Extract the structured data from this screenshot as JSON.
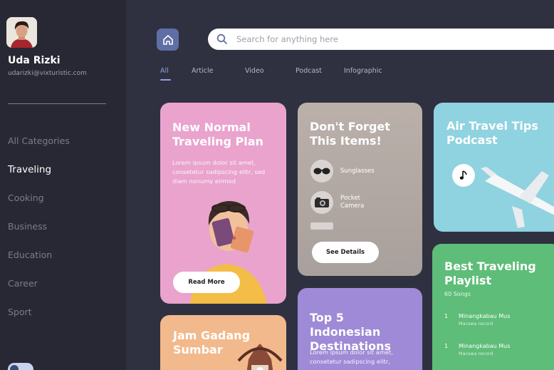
{
  "user": {
    "name": "Uda Rizki",
    "email": "udarizki@vixturistic.com"
  },
  "sidebar": {
    "items": [
      {
        "label": "All Categories"
      },
      {
        "label": "Traveling"
      },
      {
        "label": "Cooking"
      },
      {
        "label": "Business"
      },
      {
        "label": "Education"
      },
      {
        "label": "Career"
      },
      {
        "label": "Sport"
      }
    ],
    "active_index": 1
  },
  "search": {
    "placeholder": "Search for anything here"
  },
  "tabs": [
    {
      "label": "All"
    },
    {
      "label": "Article"
    },
    {
      "label": "Video"
    },
    {
      "label": "Podcast"
    },
    {
      "label": "Infographic"
    }
  ],
  "cards": {
    "plan": {
      "title": "New Normal Traveling Plan",
      "desc": "Lorem ipsum dolor sit amet, consetetur sadipscing elitr, sed diam nonumy eirmod",
      "button": "Read More"
    },
    "items": {
      "title": "Don't Forget This Items!",
      "entries": [
        {
          "label": "Sunglasses"
        },
        {
          "label": "Pocket Camera"
        }
      ],
      "button": "See Details"
    },
    "podcast": {
      "title": "Air Travel Tips Podcast"
    },
    "playlist": {
      "title": "Best Traveling Playlist",
      "count": "60 Songs",
      "songs": [
        {
          "num": "1",
          "title": "Minangkabau Mus",
          "artist": "Marawa record"
        },
        {
          "num": "1",
          "title": "Minangkabau Mus",
          "artist": "Marawa record"
        }
      ]
    },
    "destinations": {
      "title": "Top 5 Indonesian Destinations",
      "desc": "Lorem ipsum dolor sit amet, consetetur sadipscing elitr,"
    },
    "jam": {
      "title": "Jam Gadang Sumbar"
    }
  },
  "colors": {
    "sidebar_bg": "#272833",
    "main_bg": "#2f3140",
    "accent": "#8da3e0",
    "card_pink": "#e9a3cd",
    "card_taupe": "#b5aba6",
    "card_sky": "#8fd2e0",
    "card_green": "#5ebd78",
    "card_purple": "#9e8ad6",
    "card_peach": "#f2b98c"
  }
}
